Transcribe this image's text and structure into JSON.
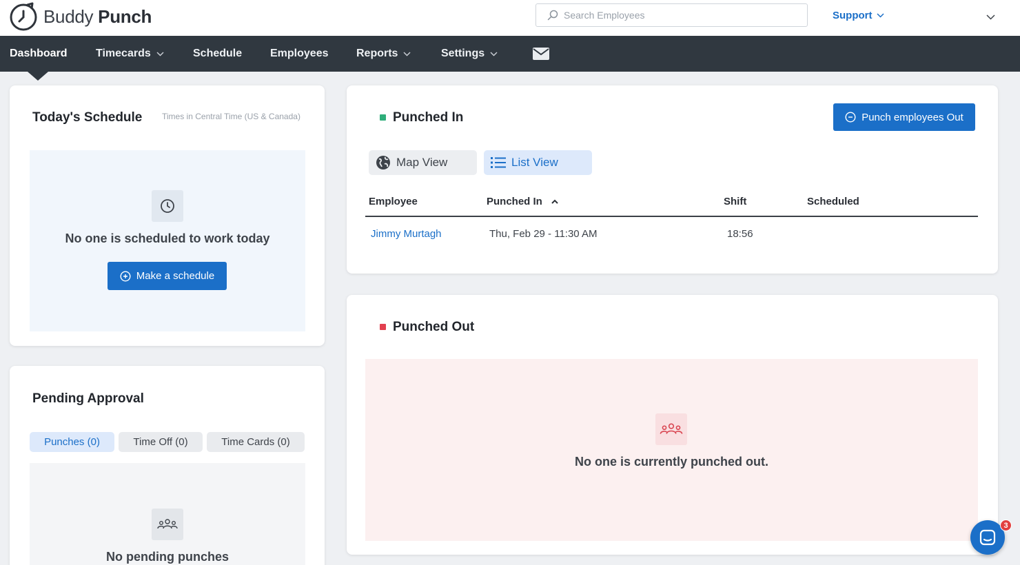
{
  "brand": {
    "name_light": "Buddy",
    "name_bold": "Punch"
  },
  "search": {
    "placeholder": "Search Employees",
    "value": ""
  },
  "header": {
    "support_label": "Support"
  },
  "nav": {
    "dashboard": "Dashboard",
    "timecards": "Timecards",
    "schedule": "Schedule",
    "employees": "Employees",
    "reports": "Reports",
    "settings": "Settings"
  },
  "schedule_card": {
    "title": "Today's Schedule",
    "timezone_note": "Times in Central Time (US & Canada)",
    "empty_text": "No one is scheduled to work today",
    "make_schedule_label": "Make a schedule"
  },
  "pending_card": {
    "title": "Pending Approval",
    "tabs": [
      {
        "label": "Punches (0)",
        "active": true
      },
      {
        "label": "Time Off (0)",
        "active": false
      },
      {
        "label": "Time Cards (0)",
        "active": false
      }
    ],
    "empty_text": "No pending punches"
  },
  "punched_in_card": {
    "title": "Punched In",
    "punch_out_label": "Punch employees Out",
    "views": {
      "map": "Map View",
      "list": "List View",
      "active": "list"
    },
    "columns": [
      "Employee",
      "Punched In",
      "Shift",
      "Scheduled"
    ],
    "sort_column": "Punched In",
    "sort_direction": "ascending",
    "rows": [
      {
        "employee": "Jimmy Murtagh",
        "punched_in": "Thu, Feb 29 - 11:30 AM",
        "shift": "18:56",
        "scheduled": ""
      }
    ]
  },
  "punched_out_card": {
    "title": "Punched Out",
    "empty_text": "No one is currently punched out."
  },
  "chat": {
    "badge_count": "3"
  },
  "colors": {
    "accent_blue": "#1b6fc8",
    "nav_background": "#303840",
    "punched_in_status": "#2fae7a",
    "punched_out_status": "#e2404f"
  }
}
